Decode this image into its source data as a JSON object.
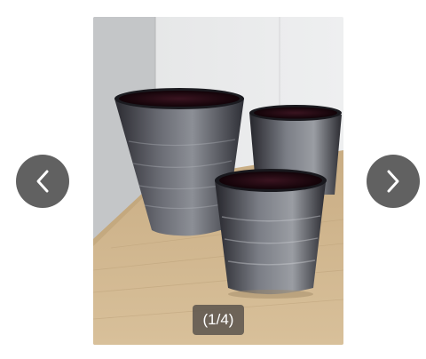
{
  "gallery": {
    "counter_text": "(1/4)",
    "current_index": 1,
    "total": 4,
    "image_subject": "three-glass-vases-photo",
    "prev_icon": "chevron-left-icon",
    "next_icon": "chevron-right-icon"
  },
  "colors": {
    "nav_button_bg": "#616161",
    "counter_bg": "#5a544c",
    "icon_color": "#ffffff"
  }
}
